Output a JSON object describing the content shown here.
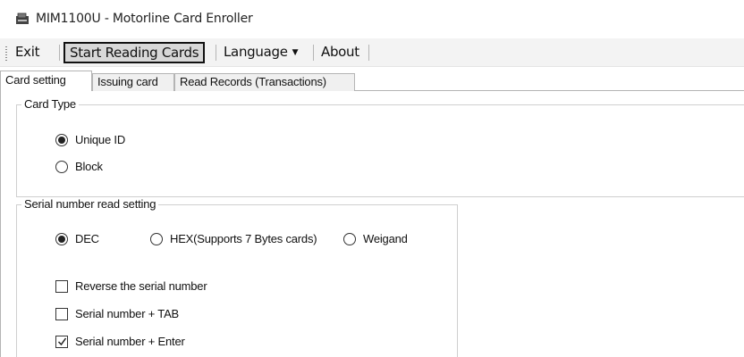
{
  "window": {
    "title": "MIM1100U - Motorline Card Enroller",
    "icon": "card-reader-icon"
  },
  "menubar": {
    "exit": "Exit",
    "start_reading": "Start Reading Cards",
    "language": "Language",
    "about": "About"
  },
  "tabs": [
    {
      "label": "Card setting",
      "active": true
    },
    {
      "label": "Issuing card",
      "active": false
    },
    {
      "label": "Read Records (Transactions)",
      "active": false
    }
  ],
  "card_type": {
    "legend": "Card Type",
    "options": [
      {
        "label": "Unique ID",
        "checked": true
      },
      {
        "label": "Block",
        "checked": false
      }
    ]
  },
  "serial_read": {
    "legend": "Serial number read setting",
    "formats": [
      {
        "label": "DEC",
        "checked": true
      },
      {
        "label": "HEX(Supports 7 Bytes cards)",
        "checked": false
      },
      {
        "label": "Weigand",
        "checked": false
      }
    ],
    "checkboxes": [
      {
        "label": "Reverse the serial number",
        "checked": false
      },
      {
        "label": "Serial number + TAB",
        "checked": false
      },
      {
        "label": "Serial number + Enter",
        "checked": true
      }
    ]
  }
}
